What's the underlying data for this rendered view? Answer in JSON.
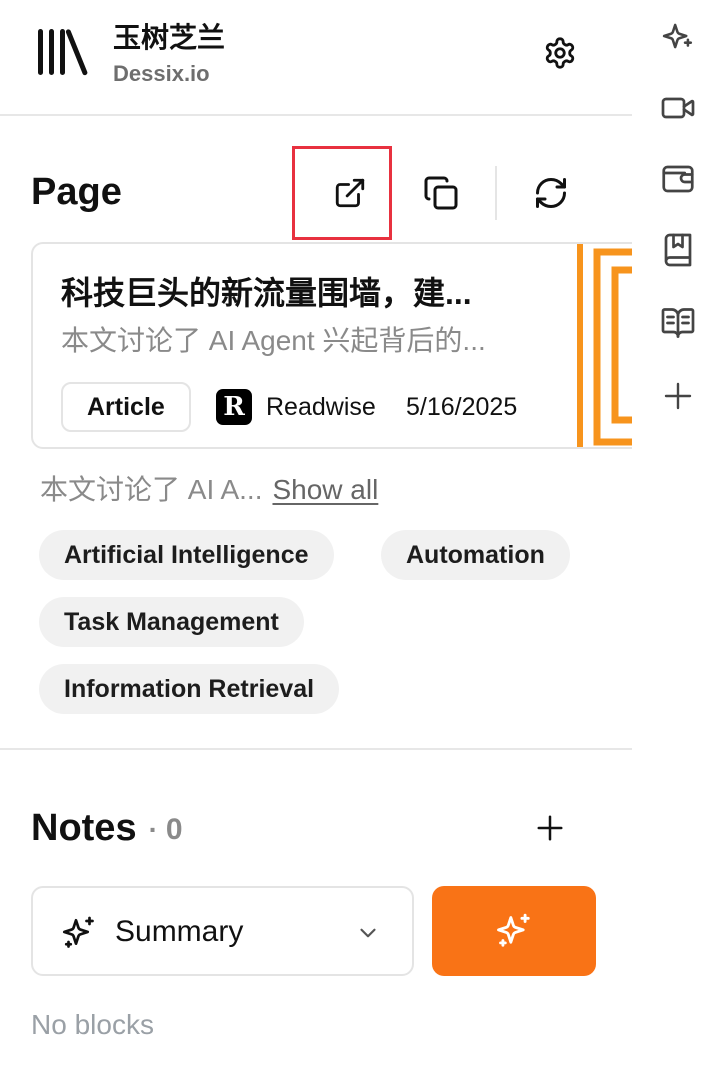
{
  "header": {
    "workspace_name": "玉树芝兰",
    "workspace_subtitle": "Dessix.io",
    "settings_icon": "gear-icon",
    "logo_icon": "library-logo-icon"
  },
  "page": {
    "title": "Page",
    "actions": [
      {
        "name": "open-external-icon",
        "highlighted": true
      },
      {
        "name": "copy-icon"
      },
      {
        "name": "refresh-icon"
      }
    ],
    "card": {
      "title": "科技巨头的新流量围墙，建...",
      "description": "本文讨论了 AI Agent 兴起背后的...",
      "type": "Article",
      "source_logo": "R",
      "source": "Readwise",
      "date": "5/16/2025"
    },
    "summary_preview": "本文讨论了 AI A...",
    "show_all": "Show all",
    "tags": [
      "Artificial Intelligence",
      "Automation",
      "Task Management",
      "Information Retrieval"
    ]
  },
  "notes": {
    "title": "Notes",
    "separator": "·",
    "count": "0",
    "mode_label": "Summary",
    "empty_text": "No blocks"
  },
  "rail": {
    "icons": [
      "sparkle-icon",
      "video-icon",
      "wallet-icon",
      "bookmark-book-icon",
      "open-book-icon",
      "plus-icon"
    ]
  },
  "colors": {
    "accent": "#f97316",
    "highlight_border": "#e8313f",
    "muted_text": "#8a8a8a"
  }
}
